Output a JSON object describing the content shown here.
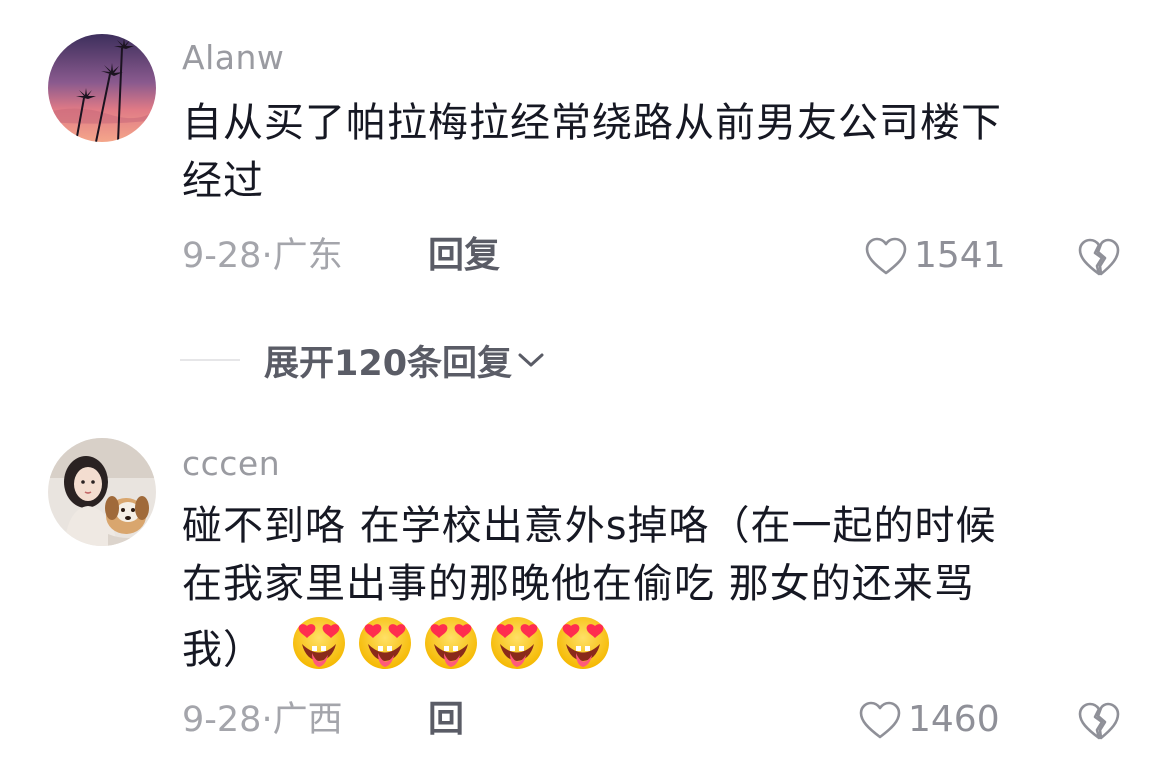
{
  "comments": [
    {
      "username": "Alanw",
      "lines": [
        "自从买了帕拉梅拉经常绕路从前男友公司楼下",
        "经过"
      ],
      "date": "9-28",
      "separator": "·",
      "location": "广东",
      "reply_label": "回复",
      "like_count": "1541",
      "avatar_icon": "sunset-palm-avatar"
    },
    {
      "username": "cccen",
      "lines": [
        "碰不到咯 在学校出意外s掉咯（在一起的时候",
        "在我家里出事的那晚他在偷吃 那女的还来骂",
        "我）"
      ],
      "emoji_icon": "heart-eyes-tongue-emoji",
      "emoji_count": 5,
      "date": "9-28",
      "separator": "·",
      "location": "广西",
      "reply_label": "回复",
      "like_count": "1460",
      "avatar_icon": "girl-with-dog-avatar"
    }
  ],
  "expand_replies": {
    "label": "展开120条回复"
  },
  "colors": {
    "meta": "#a4a5ab",
    "text": "#161823",
    "action": "#5a5c66"
  }
}
